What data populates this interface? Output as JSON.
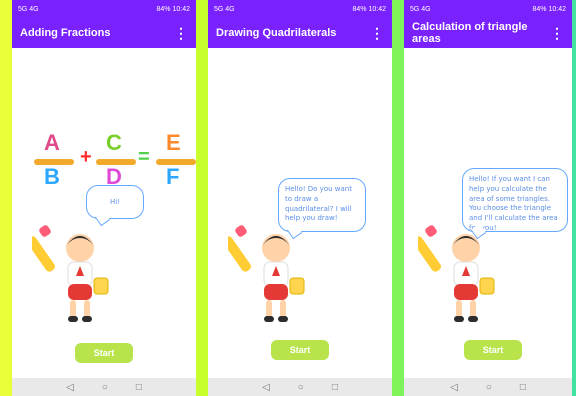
{
  "status_bar": {
    "left": "5G 4G",
    "right": "84% 10:42"
  },
  "screens": [
    {
      "title": "Adding Fractions",
      "menu_icon": "more-vert-icon",
      "fraction": {
        "a": "A",
        "b": "B",
        "c": "C",
        "d": "D",
        "e": "E",
        "f": "F",
        "plus": "+",
        "equals": "="
      },
      "bubble": "Hi!",
      "start_label": "Start"
    },
    {
      "title": "Drawing Quadrilaterals",
      "menu_icon": "more-vert-icon",
      "bubble": "Hello! Do you want to draw a quadrilateral? I will help you draw!",
      "start_label": "Start"
    },
    {
      "title": "Calculation of triangle areas",
      "menu_icon": "more-vert-icon",
      "bubble": "Hello! If you want I can help you calculate the area of some triangles. You choose the triangle and I'll calculate the area for you!",
      "start_label": "Start"
    }
  ],
  "navbar": {
    "back": "◁",
    "home": "○",
    "recent": "□"
  },
  "colors": {
    "appbar": "#7a21ff",
    "start": "#b8e34b",
    "bubble_border": "#66a8ff"
  }
}
